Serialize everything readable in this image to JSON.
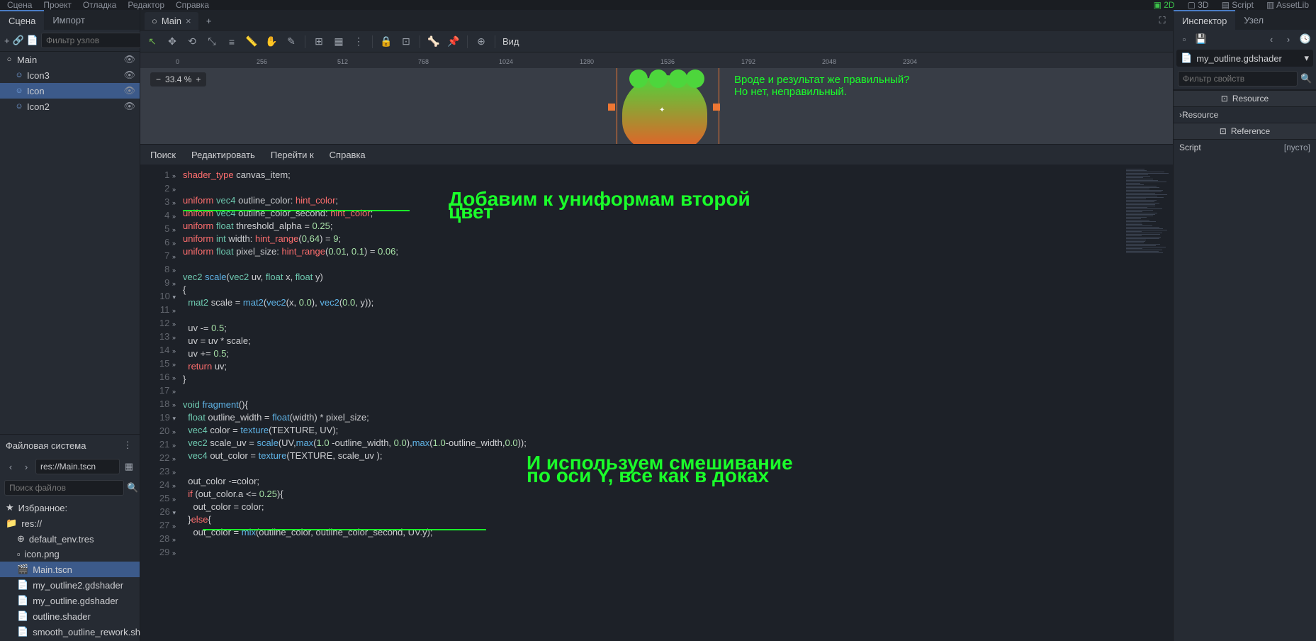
{
  "topmenu": {
    "scene": "Сцена",
    "project": "Проект",
    "debug": "Отладка",
    "editor": "Редактор",
    "help": "Справка"
  },
  "workspace_tabs": {
    "t2d": "2D",
    "t3d": "3D",
    "script": "Script",
    "assetlib": "AssetLib"
  },
  "left": {
    "tabs": {
      "scene": "Сцена",
      "import": "Импорт"
    },
    "filter_ph": "Фильтр узлов",
    "tree": {
      "root": "Main",
      "children": [
        {
          "name": "Icon3"
        },
        {
          "name": "Icon"
        },
        {
          "name": "Icon2"
        }
      ]
    },
    "fs": {
      "title": "Файловая система",
      "path": "res://Main.tscn",
      "search_ph": "Поиск файлов",
      "fav": "Избранное:",
      "root": "res://",
      "files": [
        "default_env.tres",
        "icon.png",
        "Main.tscn",
        "my_outline2.gdshader",
        "my_outline.gdshader",
        "outline.shader",
        "smooth_outline_rework.sh"
      ]
    }
  },
  "center": {
    "tab": "Main",
    "toolbar_view": "Вид",
    "zoom": "33.4 %",
    "ruler_ticks": [
      "0",
      "256",
      "512",
      "768",
      "1024",
      "1280",
      "1536",
      "1792",
      "2048",
      "2304"
    ],
    "annot1": "Вроде и результат же правильный?\nНо нет, неправильный.",
    "code_menu": {
      "search": "Поиск",
      "edit": "Редактировать",
      "goto": "Перейти к",
      "help": "Справка"
    },
    "code_lines": [
      {
        "n": 1,
        "html": "<span class='kw'>shader_type</span> <span class='ident'>canvas_item</span>;"
      },
      {
        "n": 2,
        "html": ""
      },
      {
        "n": 3,
        "html": "<span class='kw'>uniform</span> <span class='type'>vec4</span> <span class='ident'>outline_color</span>: <span class='hint'>hint_color</span>;"
      },
      {
        "n": 4,
        "html": "<span class='kw'>uniform</span> <span class='type'>vec4</span> <span class='ident'>outline_color_second</span>: <span class='hint'>hint_color</span>;"
      },
      {
        "n": 5,
        "html": "<span class='kw'>uniform</span> <span class='type'>float</span> <span class='ident'>threshold_alpha</span> = <span class='num'>0.25</span>;"
      },
      {
        "n": 6,
        "html": "<span class='kw'>uniform</span> <span class='type'>int</span> <span class='ident'>width</span>: <span class='hint'>hint_range</span>(<span class='num'>0</span>,<span class='num'>64</span>) = <span class='num'>9</span>;"
      },
      {
        "n": 7,
        "html": "<span class='kw'>uniform</span> <span class='type'>float</span> <span class='ident'>pixel_size</span>: <span class='hint'>hint_range</span>(<span class='num'>0.01</span>, <span class='num'>0.1</span>) = <span class='num'>0.06</span>;"
      },
      {
        "n": 8,
        "html": ""
      },
      {
        "n": 9,
        "html": "<span class='type'>vec2</span> <span class='fn'>scale</span>(<span class='type'>vec2</span> uv, <span class='type'>float</span> x, <span class='type'>float</span> y)"
      },
      {
        "n": 10,
        "fold": "▾",
        "html": "{"
      },
      {
        "n": 11,
        "html": "  <span class='type'>mat2</span> scale = <span class='fn'>mat2</span>(<span class='fn'>vec2</span>(x, <span class='num'>0.0</span>), <span class='fn'>vec2</span>(<span class='num'>0.0</span>, y));"
      },
      {
        "n": 12,
        "html": ""
      },
      {
        "n": 13,
        "html": "  uv -= <span class='num'>0.5</span>;"
      },
      {
        "n": 14,
        "html": "  uv = uv * scale;"
      },
      {
        "n": 15,
        "html": "  uv += <span class='num'>0.5</span>;"
      },
      {
        "n": 16,
        "html": "  <span class='kw'>return</span> uv;"
      },
      {
        "n": 17,
        "html": "}"
      },
      {
        "n": 18,
        "html": ""
      },
      {
        "n": 19,
        "fold": "▾",
        "html": "<span class='type'>void</span> <span class='fn'>fragment</span>(){"
      },
      {
        "n": 20,
        "html": "  <span class='type'>float</span> outline_width = <span class='fn'>float</span>(width) * pixel_size;"
      },
      {
        "n": 21,
        "html": "  <span class='type'>vec4</span> color = <span class='fn'>texture</span>(TEXTURE, UV);"
      },
      {
        "n": 22,
        "html": "  <span class='type'>vec2</span> scale_uv = <span class='fn'>scale</span>(UV,<span class='fn'>max</span>(<span class='num'>1.0</span> -outline_width, <span class='num'>0.0</span>),<span class='fn'>max</span>(<span class='num'>1.0</span>-outline_width,<span class='num'>0.0</span>));"
      },
      {
        "n": 23,
        "html": "  <span class='type'>vec4</span> out_color = <span class='fn'>texture</span>(TEXTURE, scale_uv );"
      },
      {
        "n": 24,
        "html": ""
      },
      {
        "n": 25,
        "html": "  out_color -=color;"
      },
      {
        "n": 26,
        "fold": "▾",
        "html": "  <span class='kw'>if</span> (out_color.a &lt;= <span class='num'>0.25</span>){"
      },
      {
        "n": 27,
        "html": "    out_color = color;"
      },
      {
        "n": 28,
        "html": "  }<span class='kw'>else</span>{"
      },
      {
        "n": 29,
        "html": "    out_color = <span class='fn'>mix</span>(outline_color, outline_color_second, UV.y);"
      }
    ],
    "annot2": "Добавим к униформам второй\nцвет",
    "annot3": "И используем смешивание\nпо оси Y, все как в доках"
  },
  "right": {
    "tabs": {
      "inspector": "Инспектор",
      "node": "Узел"
    },
    "resource_name": "my_outline.gdshader",
    "filter_ph": "Фильтр свойств",
    "sec_resource": "Resource",
    "resource_item": "Resource",
    "sec_reference": "Reference",
    "script_label": "Script",
    "script_val": "[пусто]"
  }
}
